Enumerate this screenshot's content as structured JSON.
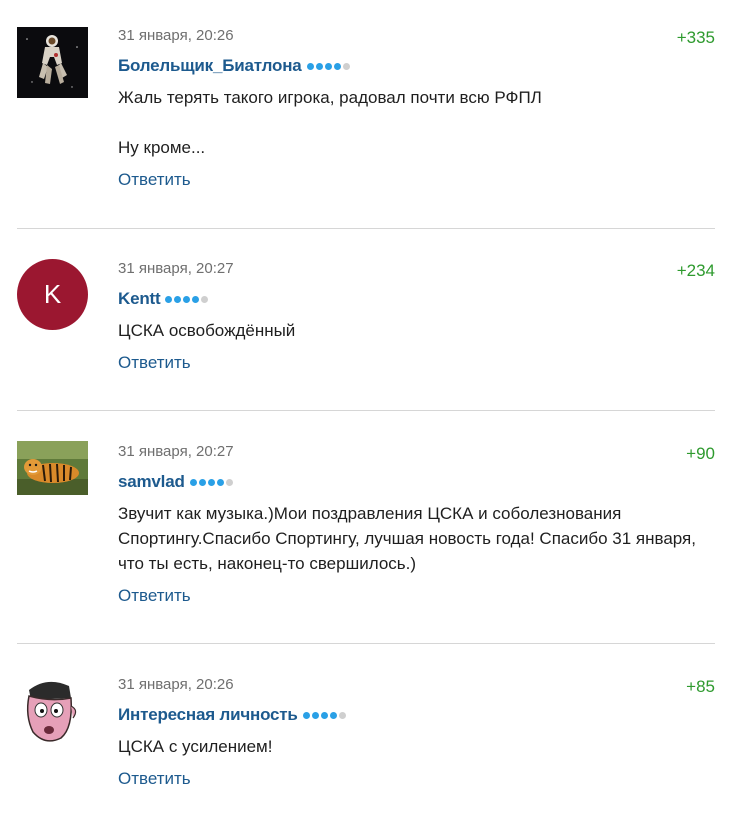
{
  "comments": [
    {
      "date": "31 января, 20:26",
      "rating": "+335",
      "author": "Болельщик_Биатлона",
      "avatar_icon": "astronaut-icon",
      "text": "Жаль терять такого игрока, радовал почти всю РФПЛ\n\nНу кроме...",
      "reply": "Ответить",
      "level": 4
    },
    {
      "date": "31 января, 20:27",
      "rating": "+234",
      "author": "Kentt",
      "avatar_letter": "K",
      "avatar_color": "#9b1730",
      "text": "ЦСКА освобождённый",
      "reply": "Ответить",
      "level": 4
    },
    {
      "date": "31 января, 20:27",
      "rating": "+90",
      "author": "samvlad",
      "avatar_icon": "tiger-icon",
      "text": "Звучит как музыка.)Мои поздравления ЦСКА и соболезнования Спортингу.Спасибо Спортингу, лучшая новость года! Спасибо 31 января, что ты есть, наконец-то свершилось.)",
      "reply": "Ответить",
      "level": 4
    },
    {
      "date": "31 января, 20:26",
      "rating": "+85",
      "author": "Интересная личность",
      "avatar_icon": "cartoon-face-icon",
      "text": "ЦСКА с усилением!",
      "reply": "Ответить",
      "level": 4
    }
  ],
  "colors": {
    "author": "#1d5a8e",
    "rating": "#2e9a2e",
    "dot_on": "#2aa0e6",
    "dot_off": "#cfcfcf"
  }
}
